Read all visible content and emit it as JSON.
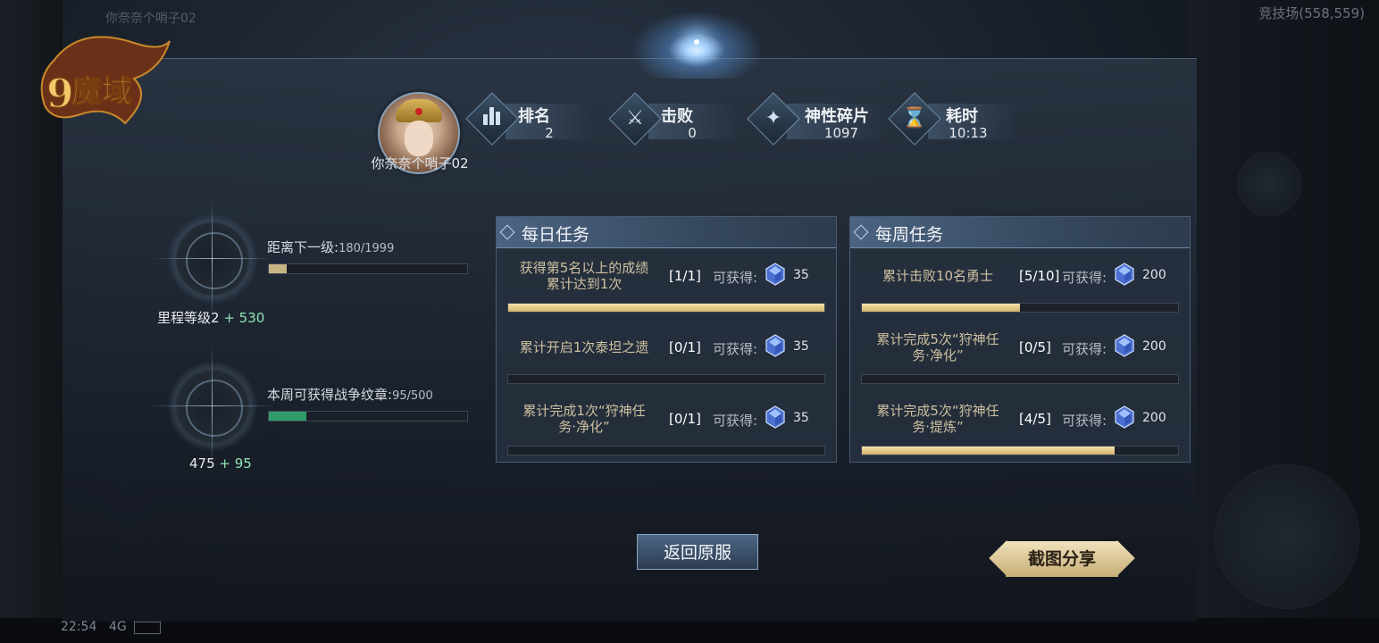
{
  "background": {
    "top_left_name": "你奈奈个哨子02",
    "arena_label": "竞技场(558,559)",
    "clock": "22:54",
    "network": "4G"
  },
  "player": {
    "name": "你奈奈个哨子02"
  },
  "stats": [
    {
      "label": "排名",
      "value": "2",
      "icon": "bar-chart-icon",
      "glyph": "▮"
    },
    {
      "label": "击败",
      "value": "0",
      "icon": "crossed-swords-icon",
      "glyph": "⚔"
    },
    {
      "label": "神性碎片",
      "value": "1097",
      "icon": "shard-icon",
      "glyph": "✦"
    },
    {
      "label": "耗时",
      "value": "10:13",
      "icon": "hourglass-icon",
      "glyph": "⌛"
    }
  ],
  "progress": [
    {
      "label": "距离下一级:",
      "value_text": "180/1999",
      "fraction": 0.09,
      "fill_color": "#c9b484",
      "summary": "里程等级2",
      "plus": "+ 530"
    },
    {
      "label": "本周可获得战争纹章:",
      "value_text": "95/500",
      "fraction": 0.19,
      "fill_color": "#2e9d6a",
      "summary": "475",
      "plus": "+ 95"
    }
  ],
  "daily": {
    "title": "每日任务",
    "reward_label": "可获得:",
    "items": [
      {
        "desc": [
          "获得第5名以上的成绩",
          "累计达到1次"
        ],
        "count": "[1/1]",
        "amount": "35",
        "fraction": 1.0
      },
      {
        "desc": [
          "累计开启1次泰坦之遗"
        ],
        "count": "[0/1]",
        "amount": "35",
        "fraction": 0.0
      },
      {
        "desc": [
          "累计完成1次“狩神任",
          "务·净化”"
        ],
        "count": "[0/1]",
        "amount": "35",
        "fraction": 0.0
      }
    ]
  },
  "weekly": {
    "title": "每周任务",
    "reward_label": "可获得:",
    "items": [
      {
        "desc": [
          "累计击败10名勇士"
        ],
        "count": "[5/10]",
        "amount": "200",
        "fraction": 0.5
      },
      {
        "desc": [
          "累计完成5次“狩神任",
          "务·净化”"
        ],
        "count": "[0/5]",
        "amount": "200",
        "fraction": 0.0
      },
      {
        "desc": [
          "累计完成5次“狩神任",
          "务·提炼”"
        ],
        "count": "[4/5]",
        "amount": "200",
        "fraction": 0.8
      }
    ]
  },
  "buttons": {
    "return": "返回原服",
    "share": "截图分享"
  },
  "colors": {
    "accent_gold": "#d1b46c",
    "bonus_green": "#8fe3b4",
    "quest_text": "#cdbf9f"
  }
}
